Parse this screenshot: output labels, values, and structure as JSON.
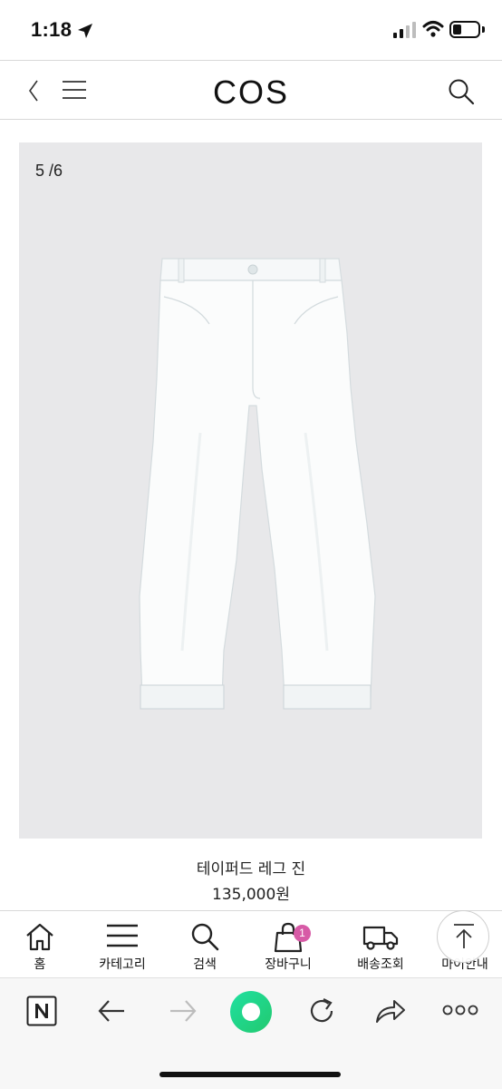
{
  "status_bar": {
    "time": "1:18"
  },
  "header": {
    "logo": "COS",
    "icons": [
      "chevron-left-icon",
      "hamburger-menu-icon",
      "search-icon"
    ]
  },
  "product": {
    "image_counter": "5 /6",
    "name": "테이퍼드 레그 진",
    "price": "135,000원"
  },
  "site_nav": {
    "items": [
      {
        "label": "홈",
        "icon": "home-icon"
      },
      {
        "label": "카테고리",
        "icon": "menu-lines-icon"
      },
      {
        "label": "검색",
        "icon": "search-icon"
      },
      {
        "label": "장바구니",
        "icon": "shopping-bag-icon"
      },
      {
        "label": "배송조회",
        "icon": "delivery-truck-icon"
      },
      {
        "label": "마이안내",
        "icon": "user-icon"
      }
    ],
    "cart_count": "1"
  },
  "browser_toolbar": {
    "icons": [
      "naver-n-icon",
      "back-arrow-icon",
      "forward-arrow-icon",
      "green-dot-icon",
      "reload-icon",
      "share-icon",
      "more-icon"
    ]
  },
  "colors": {
    "badge": "#d75aa6",
    "image_bg": "#e8e8ea",
    "green_button": "#22d884"
  }
}
